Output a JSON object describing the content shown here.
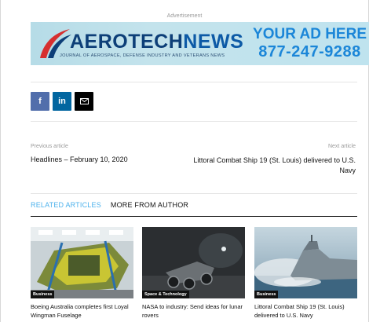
{
  "advertisement": {
    "label": "Advertisement",
    "brand_part1": "AEROTECH",
    "brand_part2": "NEWS",
    "tagline": "JOURNAL OF AEROSPACE, DEFENSE INDUSTRY AND VETERANS NEWS",
    "cta_line1": "YOUR AD HERE",
    "cta_line2": "877-247-9288",
    "colors": {
      "brand": "#0d3f78",
      "cta": "#1b86d8",
      "swoosh_red": "#d62f2f",
      "background": "#bfe3ee"
    }
  },
  "share": {
    "facebook_icon": "f",
    "linkedin_icon": "in",
    "mail_icon": "mail-icon",
    "colors": {
      "facebook": "#516eab",
      "linkedin": "#0266a0",
      "mail": "#000000"
    }
  },
  "post_nav": {
    "prev_label": "Previous article",
    "prev_title": "Headlines – February 10, 2020",
    "next_label": "Next article",
    "next_title": "Littoral Combat Ship 19 (St. Louis) delivered to U.S. Navy"
  },
  "related": {
    "tab_active": "RELATED ARTICLES",
    "tab_other": "MORE FROM AUTHOR",
    "accent": "#4db2ec",
    "articles": [
      {
        "category": "Business",
        "title": "Boeing Australia completes first Loyal Wingman Fuselage"
      },
      {
        "category": "Space & Technology",
        "title": "NASA to industry: Send ideas for lunar rovers"
      },
      {
        "category": "Business",
        "title": "Littoral Combat Ship 19 (St. Louis) delivered to U.S. Navy"
      }
    ]
  }
}
